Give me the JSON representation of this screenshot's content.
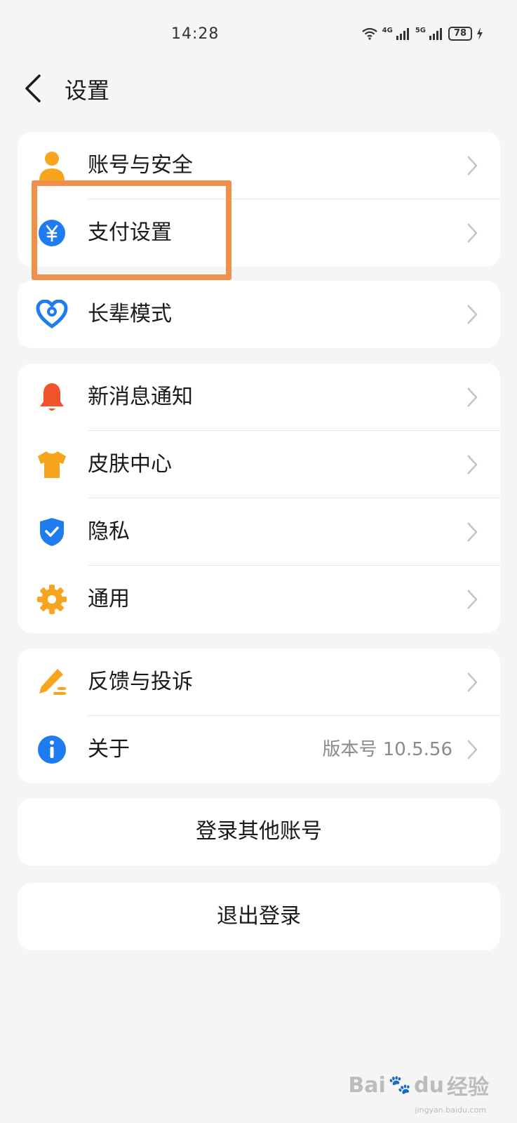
{
  "status": {
    "time": "14:28",
    "sig1": "4G",
    "sig2": "5G",
    "battery": "78"
  },
  "header": {
    "title": "设置"
  },
  "groups": [
    {
      "items": [
        {
          "label": "账号与安全",
          "icon": "person-icon"
        },
        {
          "label": "支付设置",
          "icon": "yuan-icon"
        }
      ]
    },
    {
      "items": [
        {
          "label": "长辈模式",
          "icon": "heart-icon"
        }
      ]
    },
    {
      "items": [
        {
          "label": "新消息通知",
          "icon": "bell-icon"
        },
        {
          "label": "皮肤中心",
          "icon": "shirt-icon"
        },
        {
          "label": "隐私",
          "icon": "shield-icon"
        },
        {
          "label": "通用",
          "icon": "gear-icon"
        }
      ]
    },
    {
      "items": [
        {
          "label": "反馈与投诉",
          "icon": "pencil-icon"
        },
        {
          "label": "关于",
          "icon": "info-icon",
          "value": "版本号 10.5.56"
        }
      ]
    }
  ],
  "buttons": {
    "switch_account": "登录其他账号",
    "logout": "退出登录"
  },
  "watermark": {
    "brand": "Bai",
    "brand2": "du",
    "suffix": "经验",
    "url": "jingyan.baidu.com"
  },
  "colors": {
    "highlight": "#f0904a",
    "orange": "#f7a51e",
    "blue": "#1f7cf0",
    "red": "#f0522c"
  }
}
